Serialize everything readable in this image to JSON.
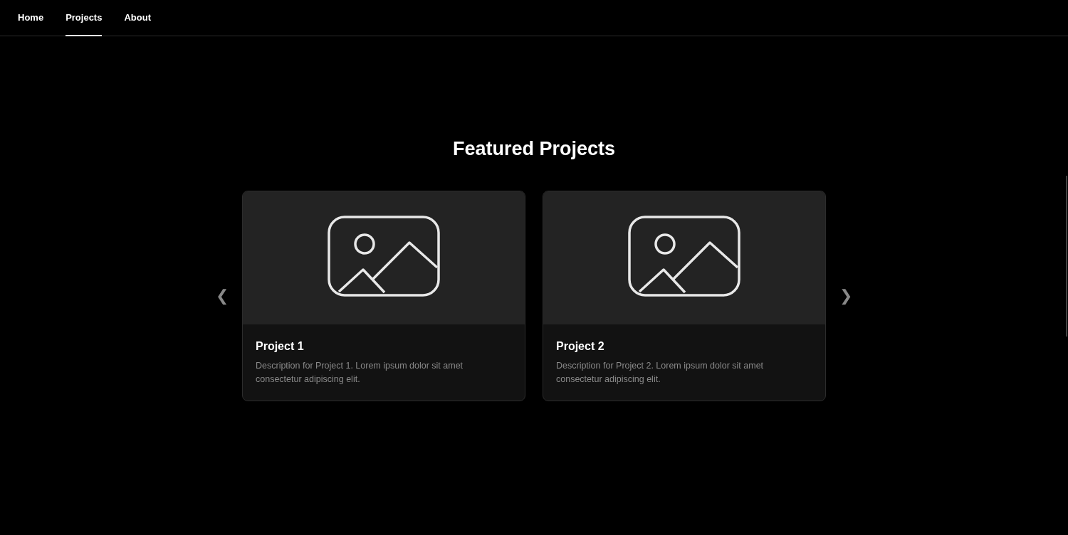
{
  "nav": {
    "items": [
      {
        "label": "Home",
        "selected": false
      },
      {
        "label": "Projects",
        "selected": true
      },
      {
        "label": "About",
        "selected": false
      }
    ]
  },
  "section": {
    "title": "Featured Projects",
    "prev_arrow": "❮",
    "next_arrow": "❯",
    "projects": [
      {
        "title": "Project 1",
        "description": "Description for Project 1. Lorem ipsum dolor sit amet consectetur adipiscing elit."
      },
      {
        "title": "Project 2",
        "description": "Description for Project 2. Lorem ipsum dolor sit amet consectetur adipiscing elit."
      }
    ]
  }
}
